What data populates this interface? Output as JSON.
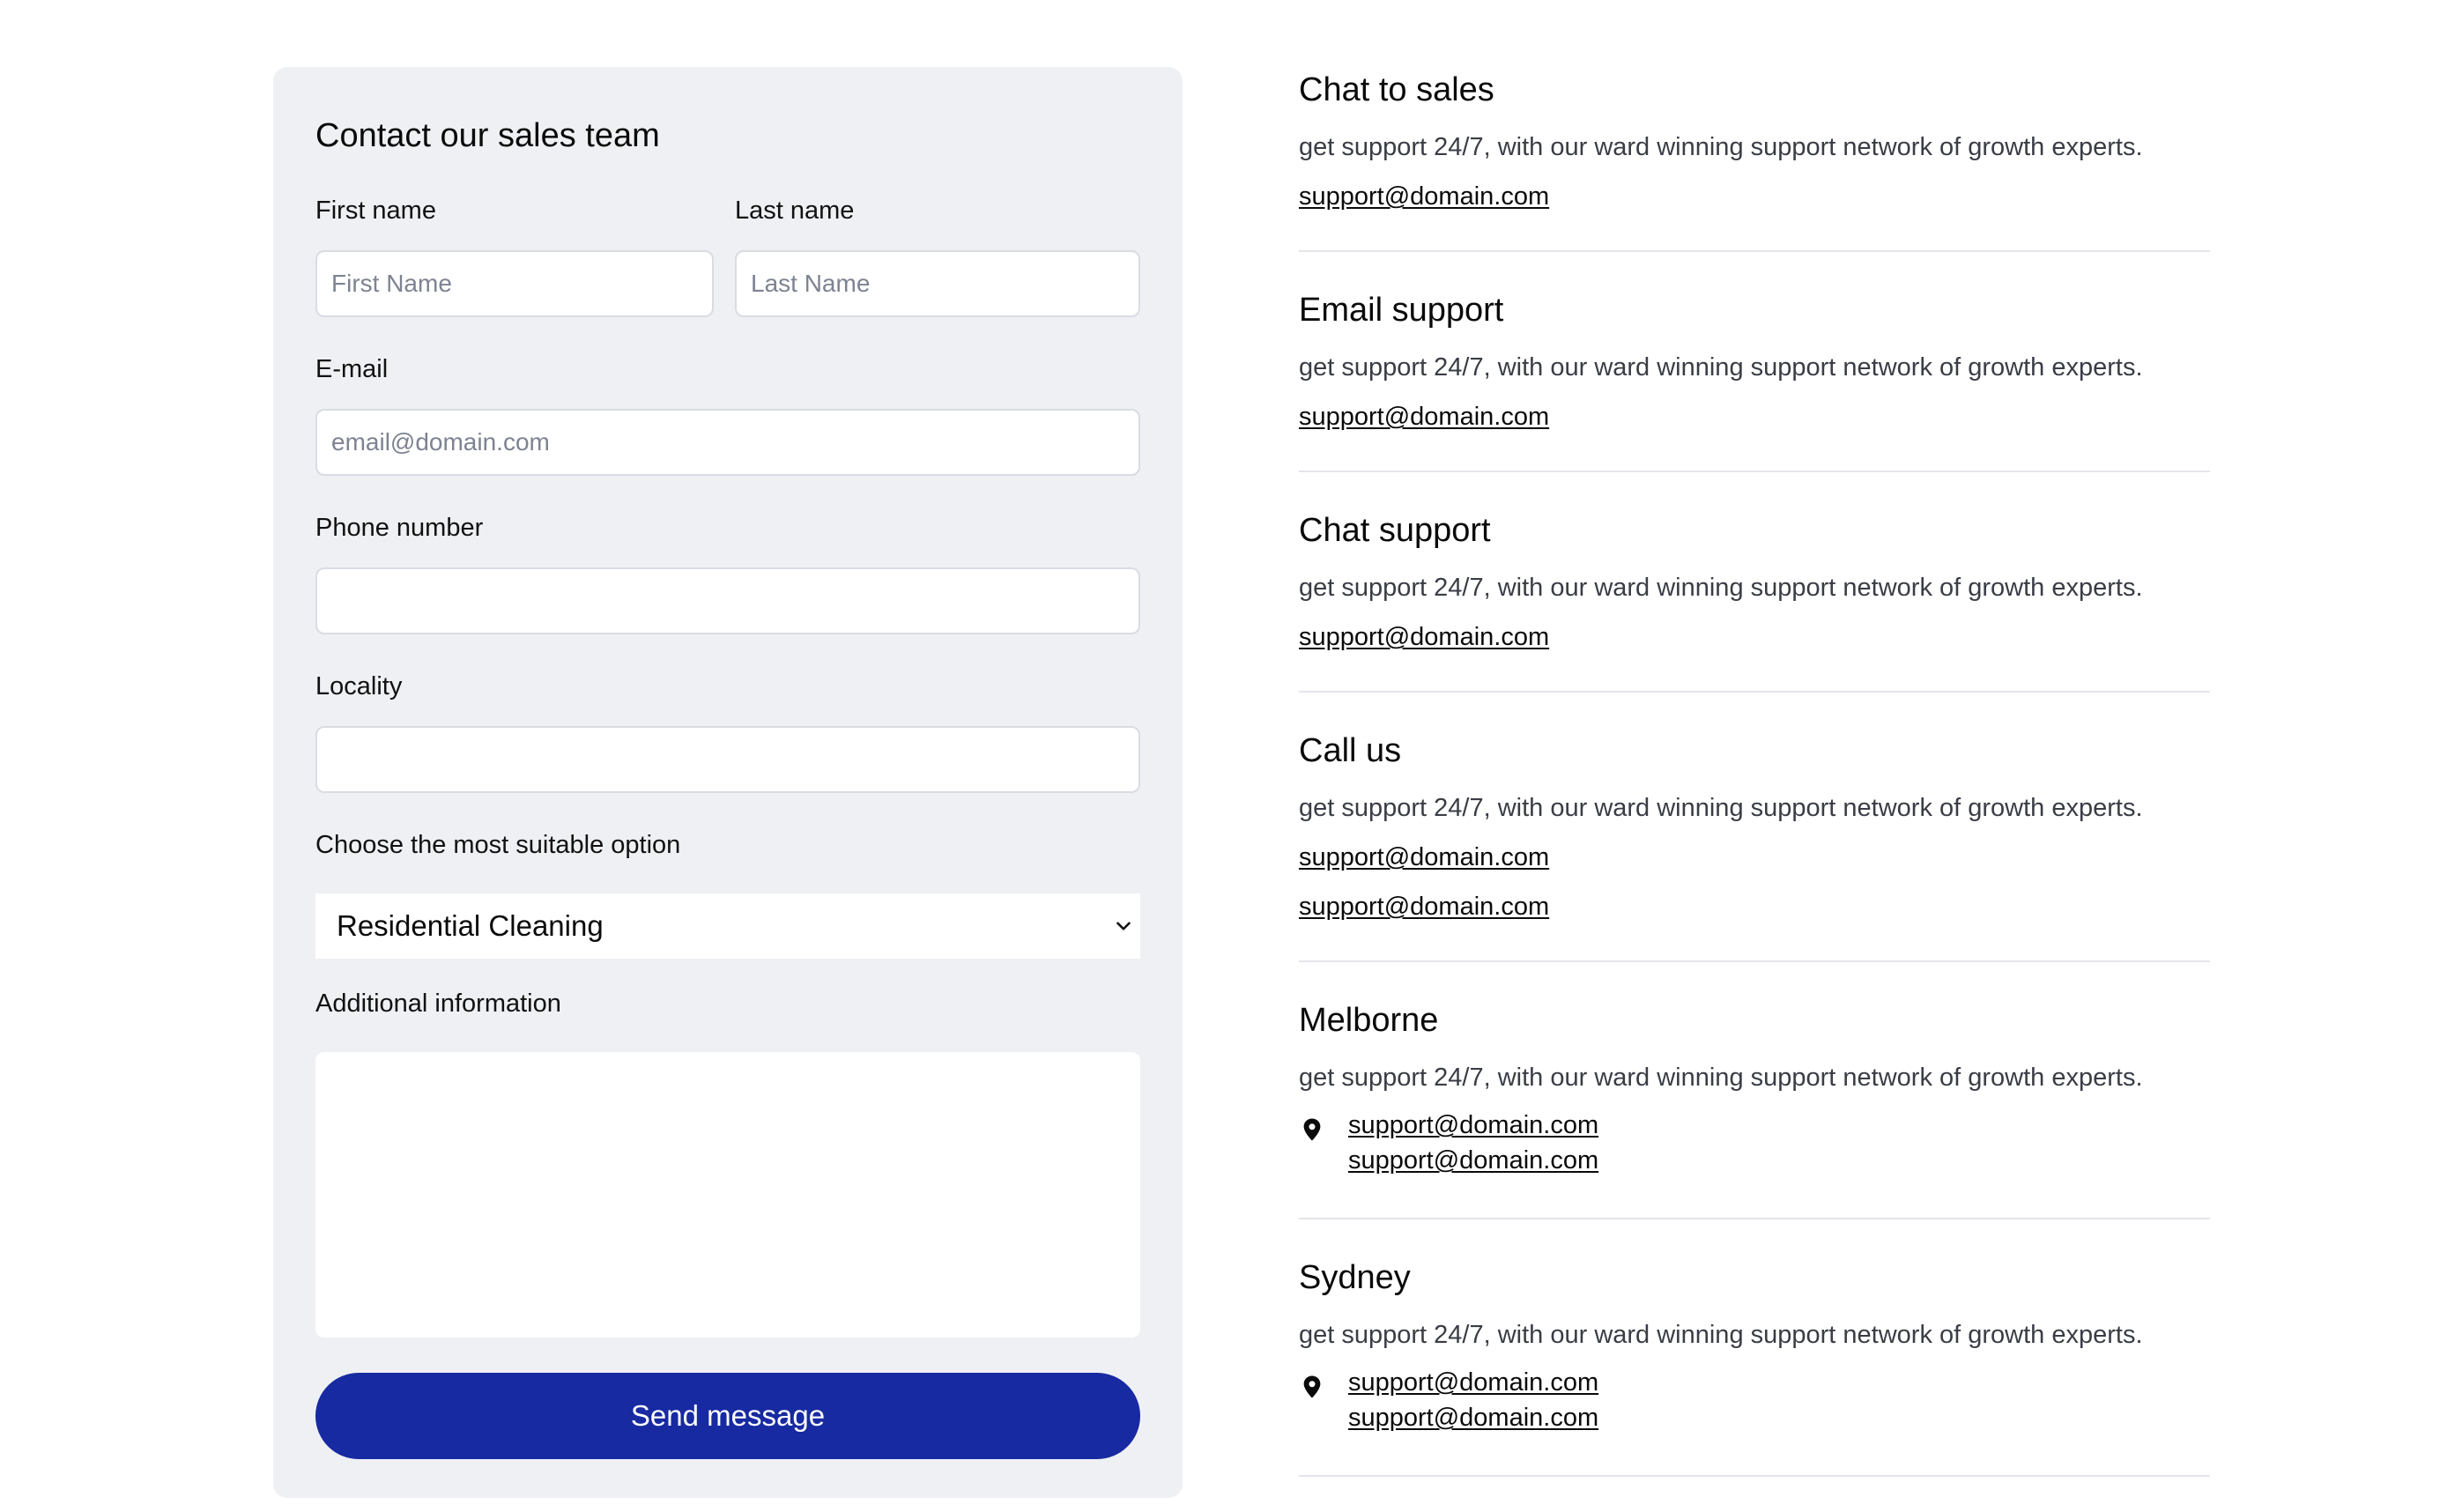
{
  "form": {
    "title": "Contact our sales team",
    "first_name_label": "First name",
    "first_name_placeholder": "First Name",
    "last_name_label": "Last name",
    "last_name_placeholder": "Last Name",
    "email_label": "E-mail",
    "email_placeholder": "email@domain.com",
    "phone_label": "Phone number",
    "locality_label": "Locality",
    "option_label": "Choose the most suitable option",
    "option_value": "Residential Cleaning",
    "additional_label": "Additional information",
    "send_label": "Send message",
    "accent_color": "#172aa1"
  },
  "contacts": [
    {
      "title": "Chat to sales",
      "description": "get support 24/7, with our ward winning support network of growth experts.",
      "links": [
        "support@domain.com"
      ]
    },
    {
      "title": "Email support",
      "description": "get support 24/7, with our ward winning support network of growth experts.",
      "links": [
        "support@domain.com"
      ]
    },
    {
      "title": "Chat support",
      "description": "get support 24/7, with our ward winning support network of growth experts.",
      "links": [
        "support@domain.com"
      ]
    },
    {
      "title": "Call us",
      "description": "get support 24/7, with our ward winning support network of growth experts.",
      "links": [
        "support@domain.com",
        "support@domain.com"
      ]
    },
    {
      "title": "Melborne",
      "description": "get support 24/7, with our ward winning support network of growth experts.",
      "icon": "location-pin-icon",
      "links": [
        "support@domain.com",
        "support@domain.com"
      ]
    },
    {
      "title": "Sydney",
      "description": "get support 24/7, with our ward winning support network of growth experts.",
      "icon": "location-pin-icon",
      "links": [
        "support@domain.com",
        "support@domain.com"
      ]
    }
  ]
}
